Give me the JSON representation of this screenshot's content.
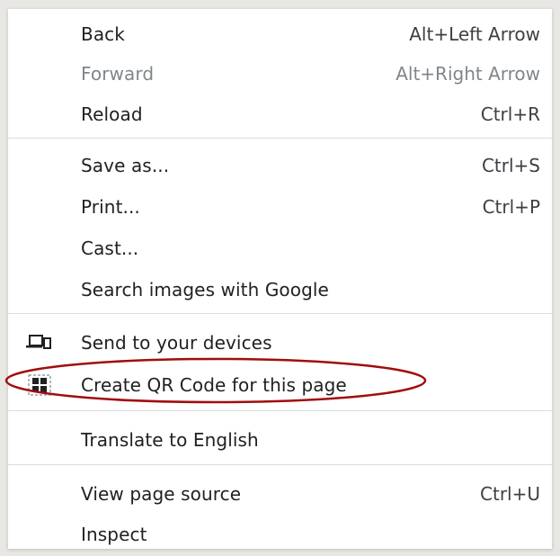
{
  "menu": {
    "items": [
      {
        "label": "Back",
        "shortcut": "Alt+Left Arrow"
      },
      {
        "label": "Forward",
        "shortcut": "Alt+Right Arrow"
      },
      {
        "label": "Reload",
        "shortcut": "Ctrl+R"
      },
      {
        "label": "Save as...",
        "shortcut": "Ctrl+S"
      },
      {
        "label": "Print...",
        "shortcut": "Ctrl+P"
      },
      {
        "label": "Cast..."
      },
      {
        "label": "Search images with Google"
      },
      {
        "label": "Send to your devices",
        "icon": "devices-icon"
      },
      {
        "label": "Create QR Code for this page",
        "icon": "qr-code-icon"
      },
      {
        "label": "Translate to English"
      },
      {
        "label": "View page source",
        "shortcut": "Ctrl+U"
      },
      {
        "label": "Inspect"
      }
    ],
    "disabled_item": "Forward"
  },
  "annotation": {
    "highlight_color": "#a00d0d",
    "highlighted_item": "Create QR Code for this page"
  },
  "colors": {
    "text": "#202124",
    "disabled_text": "#80868b",
    "separator": "#dadce0",
    "background": "#e9e7e4"
  }
}
